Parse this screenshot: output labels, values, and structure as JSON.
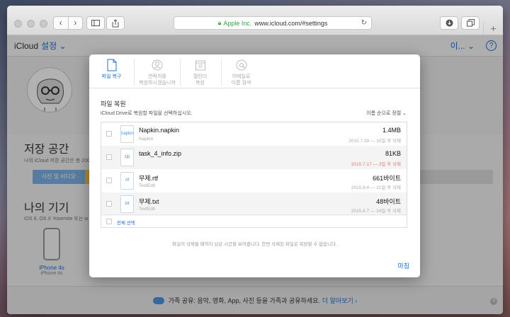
{
  "browser": {
    "address_company": "Apple Inc.",
    "address_url": "www.icloud.com/#settings",
    "newtab_label": "+"
  },
  "appbar": {
    "app_name": "iCloud",
    "section": "설정 ⌄",
    "user": "이... ⌄",
    "help": "?"
  },
  "storage": {
    "title": "저장 공간",
    "subtitle": "나의 iCloud 저장 공간은 총 20GB",
    "bar_label": "사진 및 비디오"
  },
  "devices": {
    "title": "나의 기기",
    "subtitle": "iOS 8, OS X Yosemite 또는 w",
    "device_name": "iPhone 4s",
    "device_model": "iPhone 4s"
  },
  "footer": {
    "text": "가족 공유: 음악, 영화, App, 사진 등을 가족과 공유하세요.",
    "link": "더 알아보기 ›"
  },
  "modal": {
    "tabs": [
      {
        "label1": "파일 복구",
        "label2": ""
      },
      {
        "label1": "연락처를",
        "label2": "복원하시겠습니까"
      },
      {
        "label1": "캘린더",
        "label2": "복원"
      },
      {
        "label1": "이메일로",
        "label2": "이름 검색"
      }
    ],
    "title": "파일 복원",
    "description": "iCloud Drive로 복원할 파일을 선택하십시오.",
    "sort": "이름 순으로 정렬 ⌄",
    "files": [
      {
        "name": "Napkin.napkin",
        "app": "Napkin",
        "size": "1.4MB",
        "date": "2015.7.29 — 15일 후 삭제",
        "icon_text": "napkin"
      },
      {
        "name": "task_4_info.zip",
        "app": "",
        "size": "81KB",
        "date": "2015.7.17 — 3일 후 삭제",
        "icon_text": "zip"
      },
      {
        "name": "무제.rtf",
        "app": "TextEdit",
        "size": "661바이트",
        "date": "2015.8.4 — 21일 후 삭제",
        "icon_text": "rtf"
      },
      {
        "name": "무제.txt",
        "app": "TextEdit",
        "size": "48바이트",
        "date": "2015.8.7 — 24일 후 삭제",
        "icon_text": "txt"
      }
    ],
    "select_all": "전체 선택",
    "note": "파일이 삭제될 때까지 남은 시간을 보여줍니다. 한번 삭제된 파일은 복원할 수 없습니다.",
    "done": "마침"
  },
  "colors": {
    "accent": "#1f6fd2",
    "warning": "#e07a7a",
    "secure": "#36a24a"
  }
}
